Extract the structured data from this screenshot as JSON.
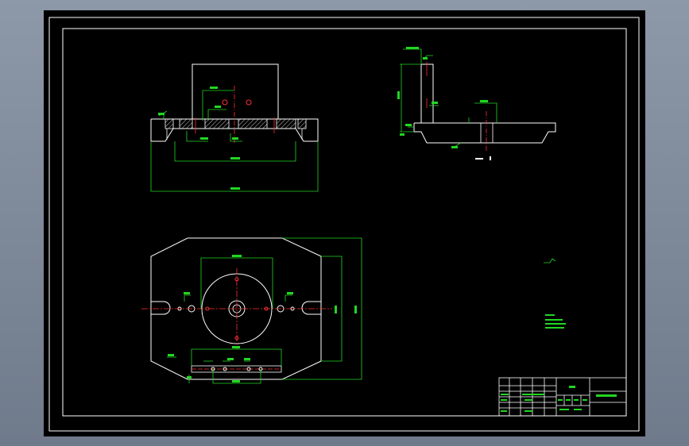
{
  "colors": {
    "outline": "#ffffff",
    "dimension": "#22d622",
    "centerline": "#ff3030",
    "hatch": "#c8c8c8",
    "background": "#000000",
    "window": "#7b8696"
  }
}
